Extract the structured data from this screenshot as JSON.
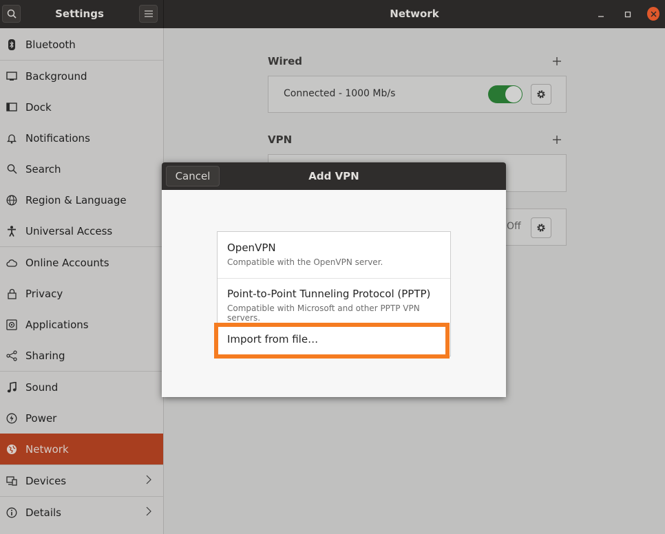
{
  "titlebar": {
    "app_title": "Settings",
    "panel_title": "Network"
  },
  "sidebar": {
    "items": [
      {
        "label": "Bluetooth",
        "icon": "bluetooth-icon"
      },
      {
        "label": "Background",
        "icon": "background-icon"
      },
      {
        "label": "Dock",
        "icon": "dock-icon"
      },
      {
        "label": "Notifications",
        "icon": "bell-icon"
      },
      {
        "label": "Search",
        "icon": "search-icon"
      },
      {
        "label": "Region & Language",
        "icon": "globe-icon"
      },
      {
        "label": "Universal Access",
        "icon": "accessibility-icon"
      },
      {
        "label": "Online Accounts",
        "icon": "cloud-icon"
      },
      {
        "label": "Privacy",
        "icon": "lock-icon"
      },
      {
        "label": "Applications",
        "icon": "applications-icon"
      },
      {
        "label": "Sharing",
        "icon": "share-icon"
      },
      {
        "label": "Sound",
        "icon": "music-note-icon"
      },
      {
        "label": "Power",
        "icon": "power-icon"
      },
      {
        "label": "Network",
        "icon": "network-icon"
      },
      {
        "label": "Devices",
        "icon": "devices-icon"
      },
      {
        "label": "Details",
        "icon": "info-icon"
      }
    ],
    "active": "Network"
  },
  "network": {
    "wired_title": "Wired",
    "wired_status": "Connected - 1000 Mb/s",
    "wired_enabled": true,
    "vpn_title": "VPN",
    "proxy_status": "Off"
  },
  "dialog": {
    "title": "Add VPN",
    "cancel_label": "Cancel",
    "options": [
      {
        "title": "OpenVPN",
        "subtitle": "Compatible with the OpenVPN server."
      },
      {
        "title": "Point-to-Point Tunneling Protocol (PPTP)",
        "subtitle": "Compatible with Microsoft and other PPTP VPN servers."
      },
      {
        "title": "Import from file…"
      }
    ]
  },
  "colors": {
    "accent": "#a83e1f",
    "highlight": "#f57c21",
    "toggle_on": "#297833"
  }
}
